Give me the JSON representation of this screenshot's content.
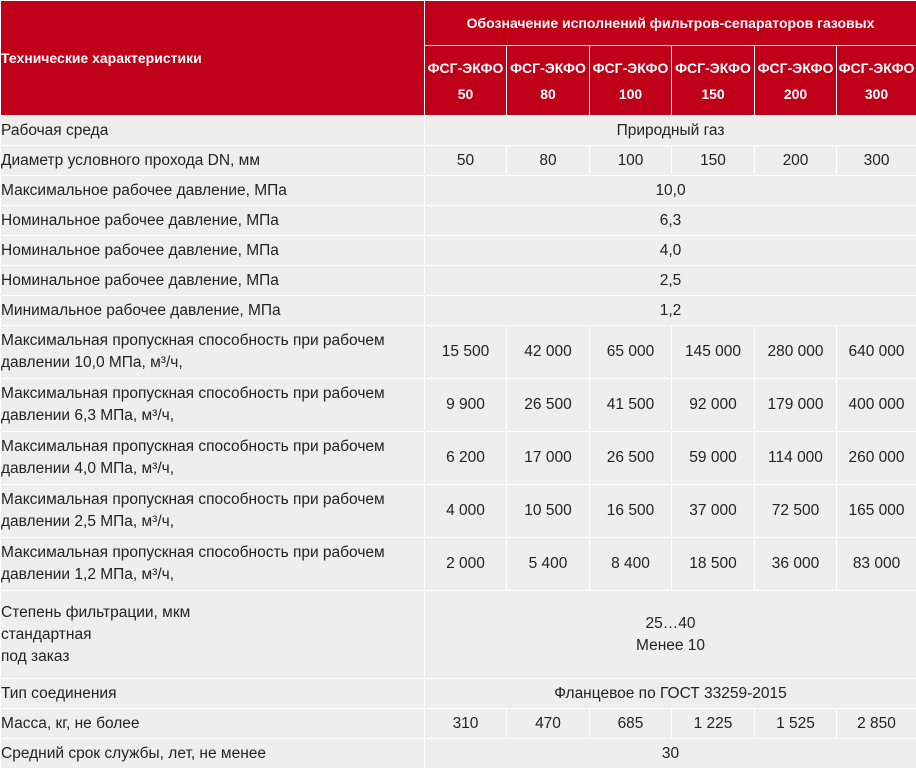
{
  "header": {
    "characteristics_label": "Технические характеристики",
    "designation_label": "Обозначение исполнений фильтров-сепараторов газовых",
    "models": [
      {
        "line1": "ФСГ-ЭКФО",
        "line2": "50"
      },
      {
        "line1": "ФСГ-ЭКФО",
        "line2": "80"
      },
      {
        "line1": "ФСГ-ЭКФО",
        "line2": "100"
      },
      {
        "line1": "ФСГ-ЭКФО",
        "line2": "150"
      },
      {
        "line1": "ФСГ-ЭКФО",
        "line2": "200"
      },
      {
        "line1": "ФСГ-ЭКФО",
        "line2": "300"
      }
    ]
  },
  "rows": {
    "medium": {
      "label": "Рабочая среда",
      "value": "Природный газ"
    },
    "dn": {
      "label": "Диаметр условного прохода DN, мм",
      "values": [
        "50",
        "80",
        "100",
        "150",
        "200",
        "300"
      ]
    },
    "max_pressure": {
      "label": "Максимальное рабочее давление, МПа",
      "value": "10,0"
    },
    "nom_pressure_1": {
      "label": "Номинальное рабочее давление, МПа",
      "value": "6,3"
    },
    "nom_pressure_2": {
      "label": "Номинальное рабочее давление, МПа",
      "value": "4,0"
    },
    "nom_pressure_3": {
      "label": "Номинальное рабочее давление, МПа",
      "value": "2,5"
    },
    "min_pressure": {
      "label": "Минимальное рабочее давление, МПа",
      "value": "1,2"
    },
    "cap_10": {
      "label_line1": "Максимальная пропускная способность при рабочем",
      "label_line2": "давлении 10,0 МПа, м³/ч,",
      "values": [
        "15 500",
        "42 000",
        "65 000",
        "145 000",
        "280 000",
        "640 000"
      ]
    },
    "cap_63": {
      "label_line1": "Максимальная пропускная способность при рабочем",
      "label_line2": "давлении 6,3 МПа, м³/ч,",
      "values": [
        "9 900",
        "26 500",
        "41 500",
        "92 000",
        "179 000",
        "400 000"
      ]
    },
    "cap_40": {
      "label_line1": "Максимальная пропускная способность при рабочем",
      "label_line2": "давлении 4,0 МПа, м³/ч,",
      "values": [
        "6 200",
        "17 000",
        "26 500",
        "59 000",
        "114 000",
        "260 000"
      ]
    },
    "cap_25": {
      "label_line1": "Максимальная пропускная способность при рабочем",
      "label_line2": "давлении 2,5 МПа, м³/ч,",
      "values": [
        "4 000",
        "10 500",
        "16 500",
        "37 000",
        "72 500",
        "165 000"
      ]
    },
    "cap_12": {
      "label_line1": "Максимальная пропускная способность при рабочем",
      "label_line2": "давлении 1,2 МПа, м³/ч,",
      "values": [
        "2 000",
        "5 400",
        "8 400",
        "18 500",
        "36 000",
        "83 000"
      ]
    },
    "filtration": {
      "label_line1": "Степень фильтрации, мкм",
      "label_line2": "стандартная",
      "label_line3": "под заказ",
      "value_line1": "25…40",
      "value_line2": "Менее 10"
    },
    "connection": {
      "label": "Тип соединения",
      "value": "Фланцевое по  ГОСТ 33259-2015"
    },
    "mass": {
      "label": "Масса, кг, не более",
      "values": [
        "310",
        "470",
        "685",
        "1 225",
        "1 525",
        "2 850"
      ]
    },
    "service_life": {
      "label": "Средний срок службы, лет, не менее",
      "value": "30"
    }
  },
  "colors": {
    "header_bg": "#c00018",
    "row_bg": "#eeeeee"
  }
}
